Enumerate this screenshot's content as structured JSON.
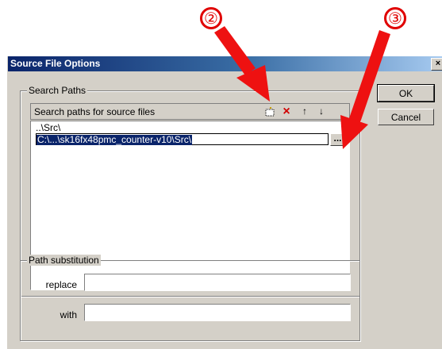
{
  "window": {
    "title": "Source File Options",
    "close_glyph": "×"
  },
  "buttons": {
    "ok": "OK",
    "cancel": "Cancel"
  },
  "search_paths": {
    "group_label": "Search Paths",
    "header_label": "Search paths for source files",
    "tools": {
      "new": "new-folder-icon",
      "delete": "×",
      "up": "↑",
      "down": "↓"
    },
    "items": [
      {
        "path": "..\\Src\\"
      },
      {
        "path": "C:\\...\\sk16fx48pmc_counter-v10\\Src\\",
        "selected": true
      }
    ],
    "browse_label": "..."
  },
  "path_substitution": {
    "group_label": "Path substitution",
    "replace_label": "replace",
    "replace_value": "",
    "with_label": "with",
    "with_value": ""
  },
  "annotations": {
    "callout_2": "②",
    "callout_3": "③",
    "arrow_color": "#ee1111"
  }
}
